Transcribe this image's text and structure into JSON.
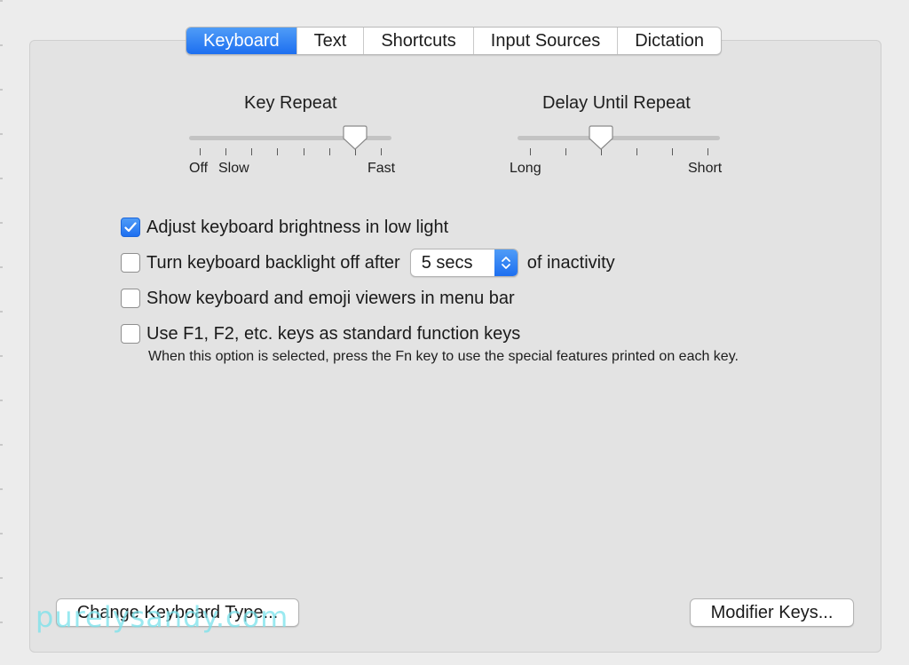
{
  "tabs": [
    {
      "label": "Keyboard",
      "active": true
    },
    {
      "label": "Text",
      "active": false
    },
    {
      "label": "Shortcuts",
      "active": false
    },
    {
      "label": "Input Sources",
      "active": false
    },
    {
      "label": "Dictation",
      "active": false
    }
  ],
  "key_repeat": {
    "title": "Key Repeat",
    "labels": {
      "off": "Off",
      "slow": "Slow",
      "fast": "Fast"
    },
    "tick_count": 8,
    "selected_index": 6
  },
  "delay_until_repeat": {
    "title": "Delay Until Repeat",
    "labels": {
      "long": "Long",
      "short": "Short"
    },
    "tick_count": 6,
    "selected_index": 2
  },
  "options": {
    "brightness": {
      "label": "Adjust keyboard brightness in low light",
      "checked": true
    },
    "backlight": {
      "label": "Turn keyboard backlight off after",
      "checked": false,
      "popup_value": "5 secs",
      "suffix": "of inactivity"
    },
    "viewers": {
      "label": "Show keyboard and emoji viewers in menu bar",
      "checked": false
    },
    "fn_keys": {
      "label": "Use F1, F2, etc. keys as standard function keys",
      "checked": false,
      "hint": "When this option is selected, press the Fn key to use the special features printed on each key."
    }
  },
  "buttons": {
    "change_type": "Change Keyboard Type...",
    "modifier_keys": "Modifier Keys..."
  },
  "watermark": "purelysandy.com",
  "colors": {
    "accent": "#1d6ff0",
    "background": "#ececec",
    "panel": "#e3e3e3"
  }
}
